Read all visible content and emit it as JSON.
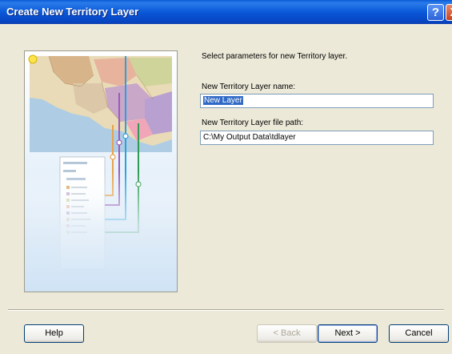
{
  "window": {
    "title": "Create New Territory Layer",
    "help_glyph": "?",
    "close_glyph": "X"
  },
  "content": {
    "intro": "Select parameters for new Territory layer.",
    "name_label": "New Territory Layer name:",
    "name_value": "New Layer",
    "path_label": "New Territory Layer file path:",
    "path_value": "C:\\My Output Data\\tdlayer"
  },
  "buttons": {
    "help": "Help",
    "back": "< Back",
    "next": "Next >",
    "cancel": "Cancel"
  },
  "colors": {
    "titlebar": "#0a58d8",
    "dialog_bg": "#ece9d8",
    "selection": "#316ac5"
  }
}
